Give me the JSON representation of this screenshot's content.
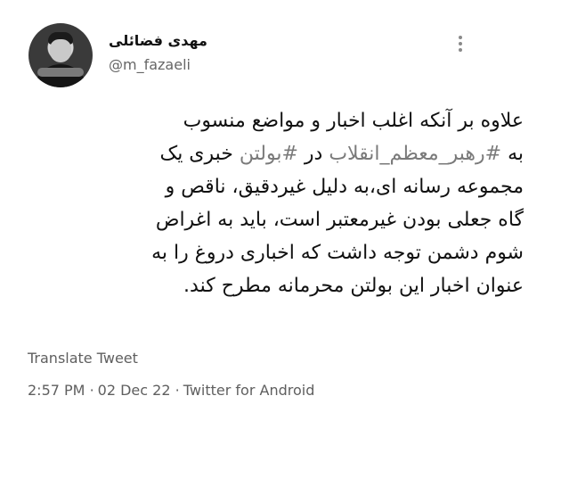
{
  "tweet": {
    "author": {
      "display_name": "مهدی فضائلی",
      "handle": "@m_fazaeli",
      "avatar_icon": "profile-photo"
    },
    "more_icon": "more-vertical-icon",
    "lines": [
      [
        "علاوه بر آنکه اغلب اخبار و مواضع منسوب"
      ],
      [
        "به ",
        "#رهبر_معظم_انقلاب",
        " در ",
        "#بولتن",
        " خبری یک"
      ],
      [
        "مجموعه رسانه ای،به دلیل غیردقیق، ناقص و"
      ],
      [
        "گاه جعلی بودن غیرمعتبر است، باید به اغراض"
      ],
      [
        "شوم دشمن توجه داشت که اخباری دروغ را به"
      ],
      [
        "عنوان اخبار این بولتن محرمانه مطرح کند."
      ]
    ],
    "translate_label": "Translate Tweet",
    "meta": {
      "time": "2:57 PM",
      "date": "02 Dec 22",
      "source": "Twitter for Android",
      "separator": "·"
    },
    "colors": {
      "hashtag": "#7a7a7a",
      "muted": "#5f5f5f",
      "text": "#111111"
    }
  }
}
